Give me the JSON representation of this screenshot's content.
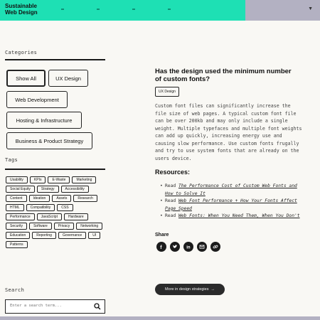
{
  "header": {
    "logo_line1": "Sustainable",
    "logo_line2": "Web Design"
  },
  "sidebar": {
    "categories_heading": "Categories",
    "categories": [
      {
        "label": "Show All",
        "active": true
      },
      {
        "label": "UX Design",
        "active": false
      },
      {
        "label": "Web Development",
        "active": false
      },
      {
        "label": "Hosting & Infrastructure",
        "active": false
      },
      {
        "label": "Business & Product Strategy",
        "active": false
      }
    ],
    "tags_heading": "Tags",
    "tags": [
      "Usability",
      "KPIs",
      "E-Waste",
      "Marketing",
      "Social Equity",
      "Strategy",
      "Accessibility",
      "Content",
      "Ideation",
      "Assets",
      "Research",
      "HTML",
      "Compatibility",
      "CSS",
      "Performance",
      "JavaScript",
      "Hardware",
      "Security",
      "Software",
      "Privacy",
      "Networking",
      "Education",
      "Reporting",
      "Governance",
      "UI",
      "Patterns"
    ],
    "search_heading": "Search",
    "search_placeholder": "Enter a search term..."
  },
  "main": {
    "title": "Has the design used the minimum number of custom fonts?",
    "tag": "UX Design",
    "body": "Custom font files can significantly increase the file size of web pages. A typical custom font file can be over 200kb and may only include a single weight. Multiple typefaces and multiple font weights can add up quickly, increasing energy use and causing slow performance. Use custom fonts frugally and try to use system fonts that are already on the users device.",
    "resources_heading": "Resources:",
    "resources": [
      {
        "prefix": "Read ",
        "link": "The Performance Cost of Custom Web Fonts and How to Solve It"
      },
      {
        "prefix": "Read ",
        "link": "Web Font Performance + How Your Fonts Affect Page Speed"
      },
      {
        "prefix": "Read ",
        "link": "Web Fonts: When You Need Them, When You Don't"
      }
    ],
    "share_heading": "Share",
    "share_icons": [
      "facebook-icon",
      "twitter-icon",
      "linkedin-icon",
      "email-icon",
      "link-icon"
    ],
    "more_button": "More in design strategies",
    "more_arrow": "→"
  },
  "colors": {
    "header": "#1ee0b4",
    "lang_bar": "#b3b1c2",
    "background": "#f9f8f4",
    "dark": "#1c1c1c"
  }
}
